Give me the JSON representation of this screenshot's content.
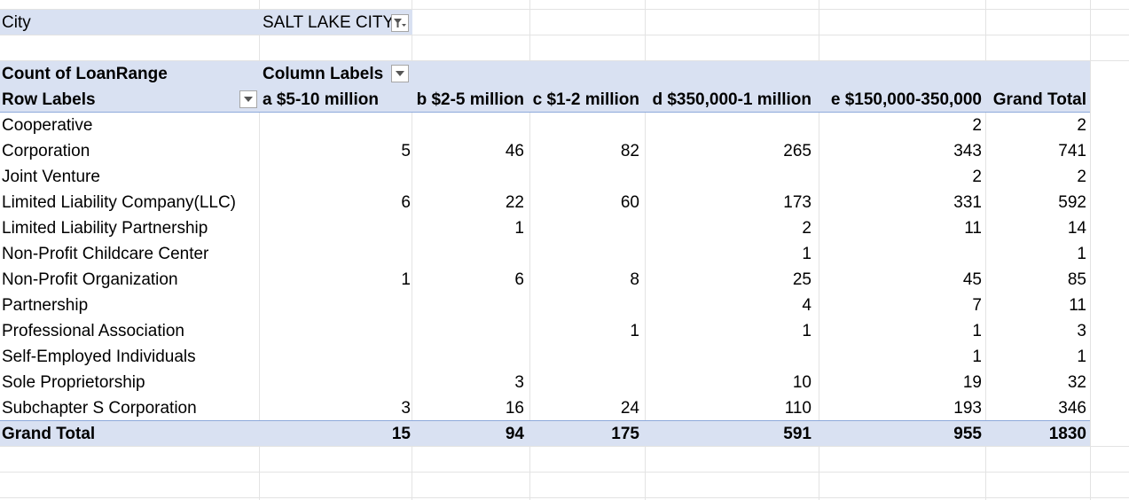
{
  "filter": {
    "label": "City",
    "value": "SALT LAKE CITY",
    "icon": "filter-dropdown-icon"
  },
  "pivot": {
    "value_header": "Count of LoanRange",
    "column_labels": "Column Labels",
    "row_labels": "Row Labels",
    "columns": [
      "a $5-10 million",
      "b $2-5 million",
      "c $1-2 million",
      "d $350,000-1 million",
      "e $150,000-350,000",
      "Grand Total"
    ],
    "rows": [
      {
        "label": "Cooperative",
        "values": [
          "",
          "",
          "",
          "",
          "2",
          "2"
        ]
      },
      {
        "label": "Corporation",
        "values": [
          "5",
          "46",
          "82",
          "265",
          "343",
          "741"
        ]
      },
      {
        "label": "Joint Venture",
        "values": [
          "",
          "",
          "",
          "",
          "2",
          "2"
        ]
      },
      {
        "label": "Limited  Liability Company(LLC)",
        "values": [
          "6",
          "22",
          "60",
          "173",
          "331",
          "592"
        ]
      },
      {
        "label": "Limited Liability Partnership",
        "values": [
          "",
          "1",
          "",
          "2",
          "11",
          "14"
        ]
      },
      {
        "label": "Non-Profit Childcare Center",
        "values": [
          "",
          "",
          "",
          "1",
          "",
          "1"
        ]
      },
      {
        "label": "Non-Profit Organization",
        "values": [
          "1",
          "6",
          "8",
          "25",
          "45",
          "85"
        ]
      },
      {
        "label": "Partnership",
        "values": [
          "",
          "",
          "",
          "4",
          "7",
          "11"
        ]
      },
      {
        "label": "Professional Association",
        "values": [
          "",
          "",
          "1",
          "1",
          "1",
          "3"
        ]
      },
      {
        "label": "Self-Employed Individuals",
        "values": [
          "",
          "",
          "",
          "",
          "1",
          "1"
        ]
      },
      {
        "label": "Sole Proprietorship",
        "values": [
          "",
          "3",
          "",
          "10",
          "19",
          "32"
        ]
      },
      {
        "label": "Subchapter S Corporation",
        "values": [
          "3",
          "16",
          "24",
          "110",
          "193",
          "346"
        ]
      }
    ],
    "grand_total": {
      "label": "Grand Total",
      "values": [
        "15",
        "94",
        "175",
        "591",
        "955",
        "1830"
      ]
    }
  },
  "colors": {
    "band": "#d9e1f2",
    "band_border": "#8ea9db",
    "gridline": "#e3e3e3"
  }
}
